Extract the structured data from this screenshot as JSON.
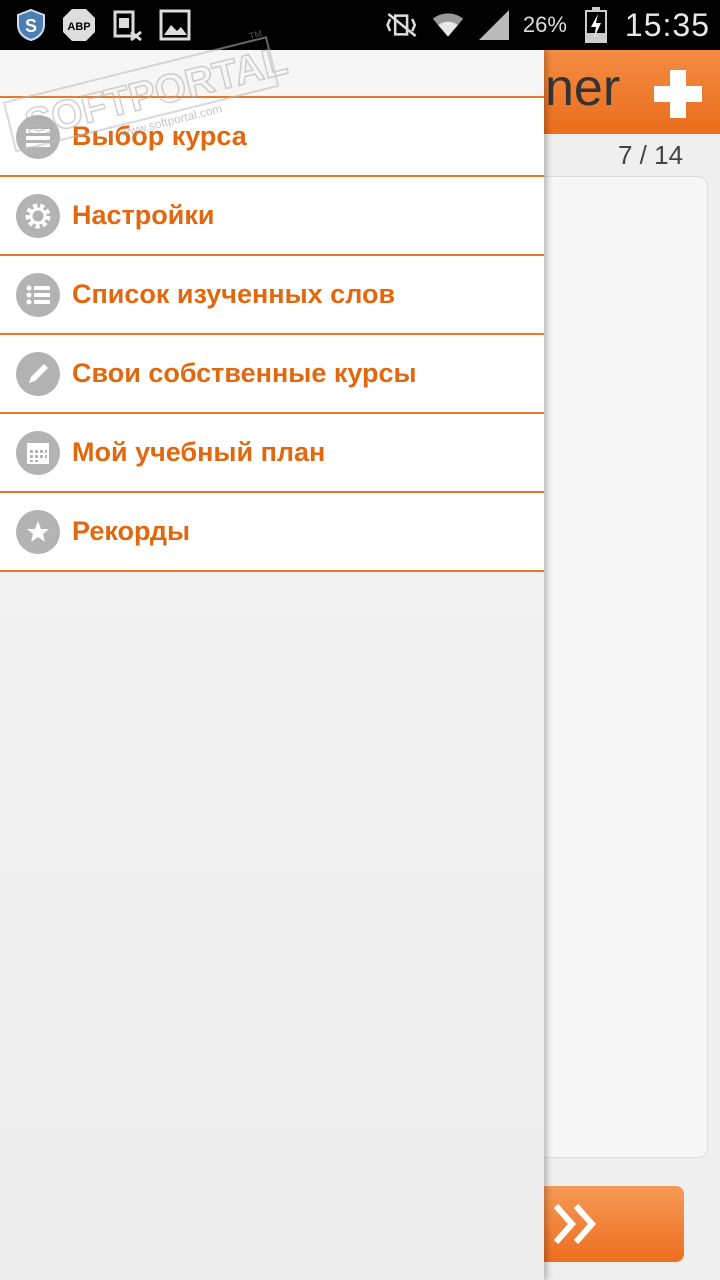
{
  "status_bar": {
    "battery_percent": "26%",
    "time": "15:35",
    "icons": [
      "shield-icon",
      "adblock-icon",
      "sim-off-icon",
      "image-icon",
      "mute-vibrate-icon",
      "wifi-icon",
      "signal-icon",
      "battery-charging-icon"
    ],
    "adblock_text": "ABP"
  },
  "background_app": {
    "title_fragment": "ner",
    "counter": "7 / 14"
  },
  "drawer": {
    "items": [
      {
        "label": "Выбор курса",
        "icon": "course-list-icon"
      },
      {
        "label": "Настройки",
        "icon": "gear-icon"
      },
      {
        "label": "Список изученных слов",
        "icon": "list-icon"
      },
      {
        "label": "Свои собственные курсы",
        "icon": "pencil-icon"
      },
      {
        "label": "Мой учебный план",
        "icon": "calendar-icon"
      },
      {
        "label": "Рекорды",
        "icon": "star-icon"
      }
    ]
  },
  "watermark": {
    "text": "SOFTPORTAL",
    "url": "www.softportal.com",
    "tm": "TM"
  },
  "colors": {
    "accent": "#e2680f",
    "divider": "#e87a2b",
    "header": "#ee7a2a"
  }
}
